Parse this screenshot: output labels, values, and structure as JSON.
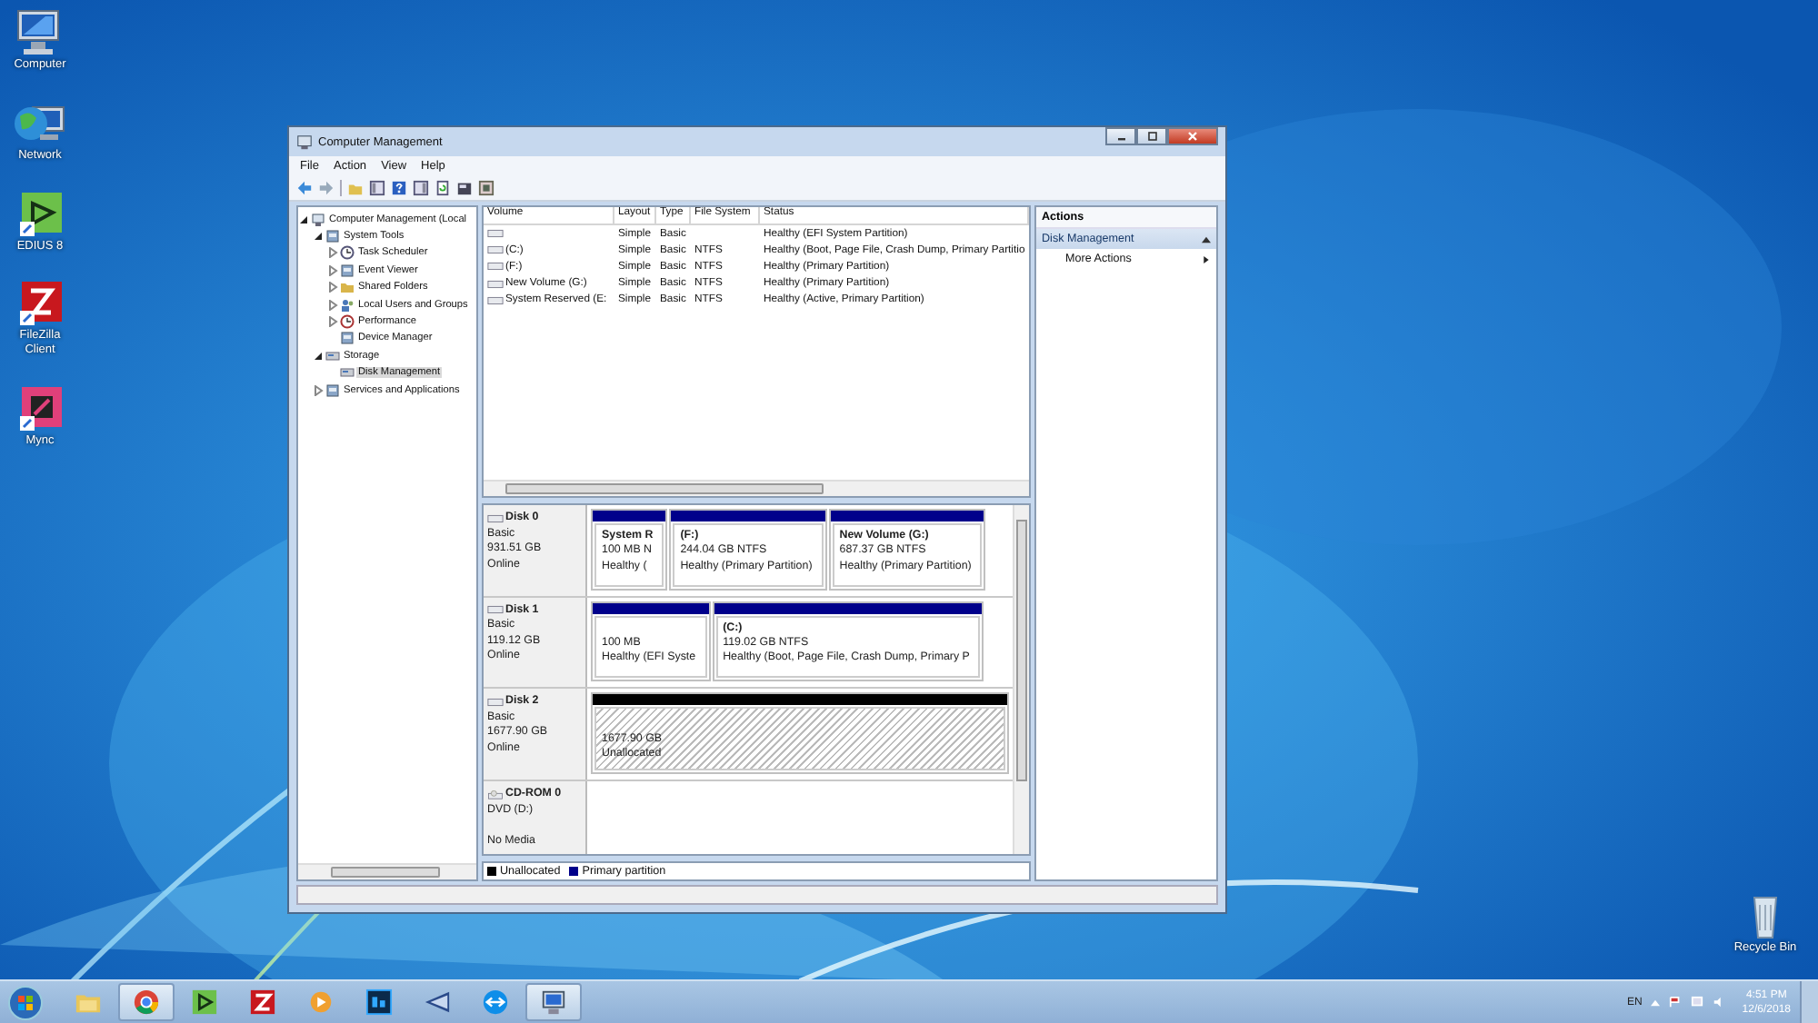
{
  "desktop_icons": [
    {
      "label": "Computer",
      "kind": "computer"
    },
    {
      "label": "Network",
      "kind": "network"
    },
    {
      "label": "EDIUS 8",
      "kind": "edius"
    },
    {
      "label": "FileZilla Client",
      "kind": "filezilla"
    },
    {
      "label": "Mync",
      "kind": "mync"
    }
  ],
  "recycle_bin": {
    "label": "Recycle Bin"
  },
  "window": {
    "title": "Computer Management",
    "menu": [
      "File",
      "Action",
      "View",
      "Help"
    ],
    "tree": [
      {
        "label": "Computer Management (Local",
        "kind": "computer",
        "expanded": true,
        "selected": false,
        "children": [
          {
            "label": "System Tools",
            "kind": "tools",
            "expanded": true,
            "selected": false,
            "children": [
              {
                "label": "Task Scheduler",
                "kind": "clock",
                "expanded": false,
                "selected": false
              },
              {
                "label": "Event Viewer",
                "kind": "viewer",
                "expanded": false,
                "selected": false
              },
              {
                "label": "Shared Folders",
                "kind": "folder",
                "expanded": false,
                "selected": false
              },
              {
                "label": "Local Users and Groups",
                "kind": "users",
                "expanded": false,
                "selected": false
              },
              {
                "label": "Performance",
                "kind": "performance",
                "expanded": false,
                "selected": false
              },
              {
                "label": "Device Manager",
                "kind": "device",
                "selected": false
              }
            ]
          },
          {
            "label": "Storage",
            "kind": "storage",
            "expanded": true,
            "selected": false,
            "children": [
              {
                "label": "Disk Management",
                "kind": "disk",
                "selected": true
              }
            ]
          },
          {
            "label": "Services and Applications",
            "kind": "services",
            "expanded": false,
            "selected": false
          }
        ]
      }
    ],
    "volumes": {
      "columns": [
        "Volume",
        "Layout",
        "Type",
        "File System",
        "Status"
      ],
      "rows": [
        [
          "",
          "Simple",
          "Basic",
          "",
          "Healthy (EFI System Partition)"
        ],
        [
          "(C:)",
          "Simple",
          "Basic",
          "NTFS",
          "Healthy (Boot, Page File, Crash Dump, Primary Partitio"
        ],
        [
          "(F:)",
          "Simple",
          "Basic",
          "NTFS",
          "Healthy (Primary Partition)"
        ],
        [
          "New Volume (G:)",
          "Simple",
          "Basic",
          "NTFS",
          "Healthy (Primary Partition)"
        ],
        [
          "System Reserved (E:",
          "Simple",
          "Basic",
          "NTFS",
          "Healthy (Active, Primary Partition)"
        ]
      ]
    },
    "disks": [
      {
        "kind": "disk",
        "name": "Disk 0",
        "type": "Basic",
        "size": "931.51 GB",
        "status": "Online",
        "partitions": [
          {
            "kind": "primary",
            "name": "System R",
            "size": "100 MB N",
            "status": "Healthy ("
          },
          {
            "kind": "primary",
            "name": "(F:)",
            "size": "244.04 GB NTFS",
            "status": "Healthy (Primary Partition)"
          },
          {
            "kind": "primary",
            "name": "New Volume  (G:)",
            "size": "687.37 GB NTFS",
            "status": "Healthy (Primary Partition)"
          }
        ]
      },
      {
        "kind": "disk",
        "name": "Disk 1",
        "type": "Basic",
        "size": "119.12 GB",
        "status": "Online",
        "partitions": [
          {
            "kind": "primary",
            "size": "100 MB",
            "status": "Healthy (EFI Syste"
          },
          {
            "kind": "primary",
            "name": "(C:)",
            "size": "119.02 GB NTFS",
            "status": "Healthy (Boot, Page File, Crash Dump, Primary P"
          }
        ]
      },
      {
        "kind": "disk",
        "name": "Disk 2",
        "type": "Basic",
        "size": "1677.90 GB",
        "status": "Online",
        "partitions": [
          {
            "kind": "unallocated",
            "size": "1677.90 GB",
            "status": "Unallocated"
          }
        ]
      },
      {
        "kind": "cdrom",
        "name": "CD-ROM 0",
        "type": "DVD (D:)",
        "status": "No Media"
      }
    ],
    "legend": [
      {
        "label": "Unallocated",
        "color": "#000000"
      },
      {
        "label": "Primary partition",
        "color": "#00008b"
      }
    ],
    "actions": {
      "title": "Actions",
      "groups": [
        {
          "title": "Disk Management",
          "expanded": true,
          "items": [
            {
              "label": "More Actions",
              "submenu": true
            }
          ]
        }
      ]
    }
  },
  "taskbar": {
    "apps": [
      {
        "kind": "explorer",
        "selected": false
      },
      {
        "kind": "chrome",
        "selected": true
      },
      {
        "kind": "edius",
        "selected": false
      },
      {
        "kind": "filezilla",
        "selected": false
      },
      {
        "kind": "player",
        "selected": false
      },
      {
        "kind": "photoshop",
        "selected": false
      },
      {
        "kind": "editor",
        "selected": false
      },
      {
        "kind": "remote",
        "selected": false
      },
      {
        "kind": "management",
        "selected": true
      }
    ],
    "language": "EN",
    "time": "4:51 PM",
    "date": "12/6/2018"
  }
}
